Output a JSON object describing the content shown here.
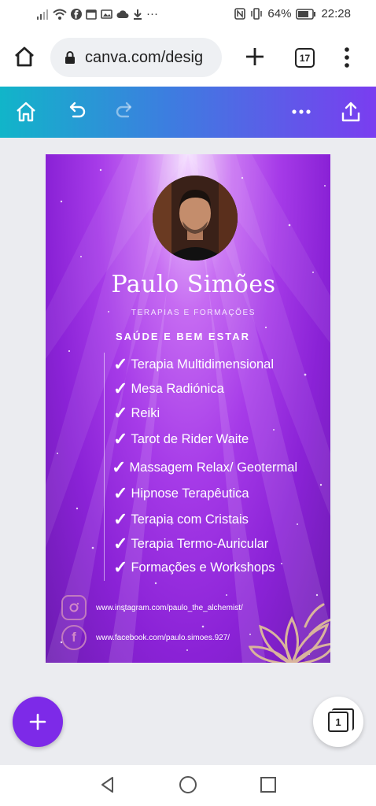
{
  "status_bar": {
    "battery": "64%",
    "time": "22:28",
    "dots": "···",
    "icons": [
      "signal-icon",
      "wifi-icon",
      "facebook-icon",
      "calendar-icon",
      "image-icon",
      "cloud-icon",
      "download-icon",
      "nfc-icon",
      "vibrate-icon",
      "battery-icon"
    ]
  },
  "browser": {
    "url": "canva.com/desig",
    "tab_count": "17"
  },
  "design": {
    "name": "Paulo Simões",
    "subtitle": "TERAPIAS E FORMAÇÕES",
    "heading": "SAÚDE E BEM ESTAR",
    "check_glyph": "✓",
    "items": [
      "Terapia Multidimensional",
      "Mesa Radiónica",
      "Reiki",
      "Tarot de Rider Waite",
      "Massagem Relax/ Geotermal",
      "Hipnose Terapêutica",
      "Terapia com Cristais",
      "Terapia Termo-Auricular",
      "Formações e Workshops"
    ],
    "instagram": "www.instagram.com/paulo_the_alchemist/",
    "facebook": "www.facebook.com/paulo.simoes.927/",
    "facebook_glyph": "f"
  },
  "pages_count": "1",
  "colors": {
    "toolbar_start": "#11b5c9",
    "toolbar_end": "#7a3df0",
    "fab": "#7d2ae8",
    "design_purple": "#8a22d6"
  }
}
